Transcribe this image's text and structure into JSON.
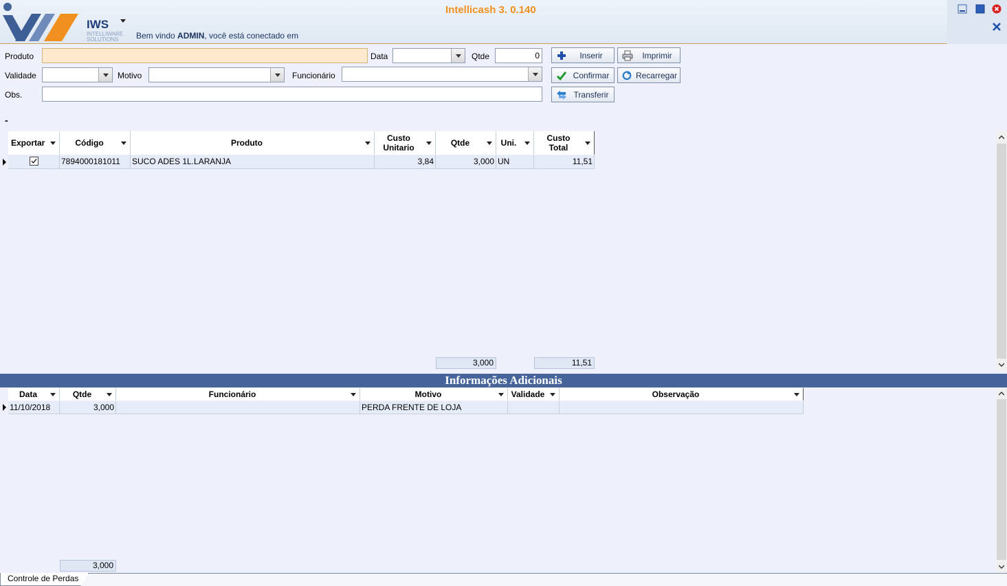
{
  "app": {
    "title": "Intellicash 3. 0.140",
    "brand": "IWS",
    "brand_sub": "INTELLIWARE SOLUTIONS",
    "welcome_prefix": "Bem vindo ",
    "welcome_user": "ADMIN",
    "welcome_suffix": ", você está conectado em",
    "accent_color": "#f0901e",
    "header_color": "#46649a"
  },
  "form": {
    "produto_label": "Produto",
    "produto_value": "",
    "data_label": "Data",
    "data_value": "",
    "qtde_label": "Qtde",
    "qtde_value": "0",
    "validade_label": "Validade",
    "validade_value": "",
    "motivo_label": "Motivo",
    "motivo_value": "",
    "funcionario_label": "Funcionário",
    "funcionario_value": "",
    "obs_label": "Obs.",
    "obs_value": ""
  },
  "buttons": {
    "inserir": "Inserir",
    "imprimir": "Imprimir",
    "confirmar": "Confirmar",
    "recarregar": "Recarregar",
    "transferir": "Transferir"
  },
  "collapse_label": "-",
  "main_grid": {
    "columns": [
      "Exportar",
      "Código",
      "Produto",
      "Custo Unitario",
      "Qtde",
      "Uni.",
      "Custo Total"
    ],
    "rows": [
      {
        "exportar": true,
        "codigo": "7894000181011",
        "produto": "SUCO ADES 1L.LARANJA",
        "custo_unitario": "3,84",
        "qtde": "3,000",
        "uni": "UN",
        "custo_total": "11,51"
      }
    ],
    "totals": {
      "qtde": "3,000",
      "custo_total": "11,51"
    }
  },
  "section_title": "Informações Adicionais",
  "detail_grid": {
    "columns": [
      "Data",
      "Qtde",
      "Funcionário",
      "Motivo",
      "Validade",
      "Observação"
    ],
    "rows": [
      {
        "data": "11/10/2018",
        "qtde": "3,000",
        "funcionario": "",
        "motivo": "PERDA FRENTE DE LOJA",
        "validade": "",
        "observacao": ""
      }
    ],
    "totals": {
      "qtde": "3,000"
    }
  },
  "tab": {
    "label": "Controle de Perdas"
  }
}
